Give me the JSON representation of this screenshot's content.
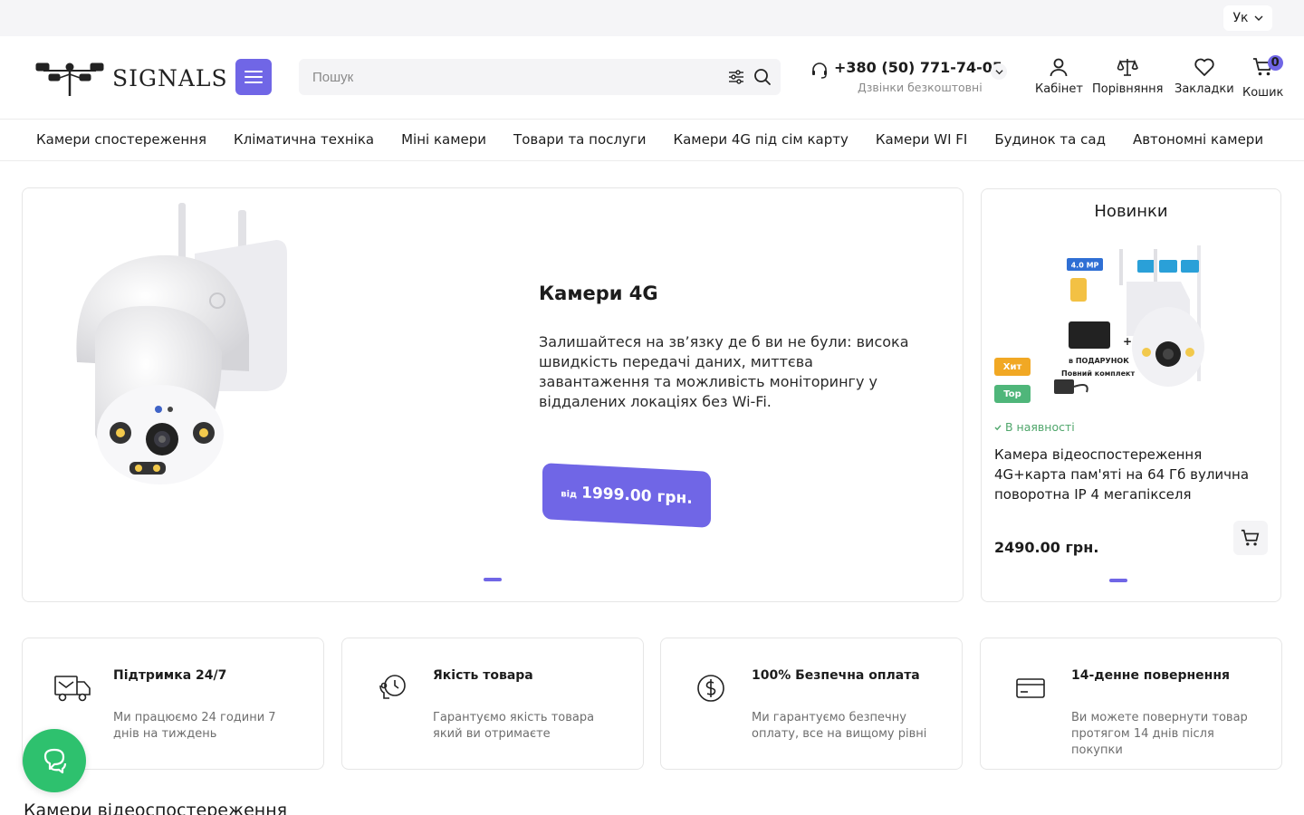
{
  "topbar": {
    "language": "Ук"
  },
  "header": {
    "logo_text": "SIGNALS",
    "search_placeholder": "Пошук",
    "phone_number": "+380 (50) 771-74-05",
    "phone_note": "Дзвінки безкоштовні",
    "actions": [
      {
        "label": "Кабінет"
      },
      {
        "label": "Порівняння"
      },
      {
        "label": "Закладки"
      },
      {
        "label": "Кошик"
      }
    ],
    "cart_count": "0"
  },
  "nav": {
    "items": [
      {
        "label": "Камери спостереження"
      },
      {
        "label": "Кліматична техніка"
      },
      {
        "label": "Міні камери"
      },
      {
        "label": "Товари та послуги"
      },
      {
        "label": "Камери 4G під сім карту"
      },
      {
        "label": "Камери WI FI"
      },
      {
        "label": "Будинок та сад"
      },
      {
        "label": "Автономні камери"
      }
    ]
  },
  "hero": {
    "title": "Камери 4G",
    "description": "Залишайтеся на зв’язку де б ви не були: висока швидкість передачі даних, миттєва завантаження та можливість моніторингу у віддалених локаціях без Wi-Fi.",
    "price_prefix": "від",
    "price": "1999.00 грн."
  },
  "new_products": {
    "title": "Новинки",
    "product": {
      "badge_hit": "Хит",
      "badge_top": "Top",
      "availability": "В наявності",
      "name": "Камера відеоспостереження 4G+карта пам'яті на 64 Гб вулична поворотна IP 4 мегапікселя",
      "price": "2490.00 грн.",
      "image_labels": {
        "resolution": "4.0 MP",
        "gift": "в ПОДАРУНОК",
        "kit": "Повний комплект"
      }
    }
  },
  "features": [
    {
      "title": "Підтримка 24/7",
      "text": "Ми працюємо 24 години 7 днів на тиждень",
      "icon": "truck-icon"
    },
    {
      "title": "Якість товара",
      "text": "Гарантуємо якість товара який ви отримаєте",
      "icon": "quality-clock-icon"
    },
    {
      "title": "100% Безпечна оплата",
      "text": "Ми гарантуємо безпечну оплату, все на вищому рівні",
      "icon": "currency-icon"
    },
    {
      "title": "14-денне повернення",
      "text": "Ви можете повернути товар протягом 14 днів після покупки",
      "icon": "card-icon"
    }
  ],
  "section": {
    "title": "Камери відеоспостереження"
  },
  "colors": {
    "accent": "#7066e6",
    "chat": "#2ec16e",
    "hit": "#f1a824",
    "top": "#4fb67a"
  }
}
